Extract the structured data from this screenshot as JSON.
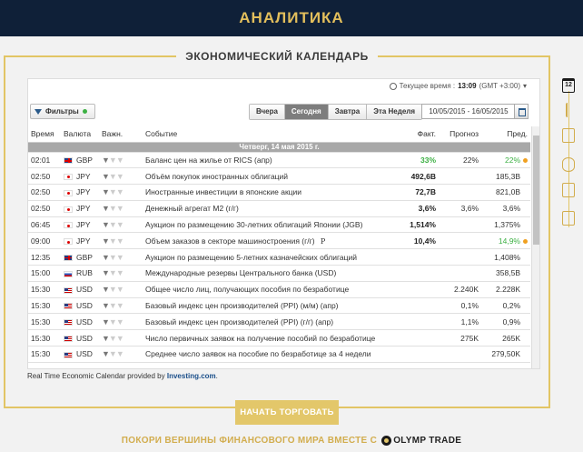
{
  "header": {
    "title": "АНАЛИТИКА"
  },
  "section": {
    "title": "ЭКОНОМИЧЕСКИЙ КАЛЕНДАРЬ"
  },
  "calendar": {
    "time_label": "Текущее время :",
    "time_value": "13:09",
    "timezone": "(GMT +3:00)",
    "filter_label": "Фильтры",
    "tabs": [
      "Вчера",
      "Сегодня",
      "Завтра",
      "Эта Неделя"
    ],
    "active_tab": "Сегодня",
    "date_range": "10/05/2015 - 16/05/2015",
    "columns": {
      "time": "Время",
      "currency": "Валюта",
      "importance": "Важн.",
      "event": "Событие",
      "actual": "Факт.",
      "forecast": "Прогноз",
      "previous": "Пред."
    },
    "day_header": "Четверг, 14 мая 2015 г.",
    "rows": [
      {
        "time": "02:01",
        "flag": "gb",
        "currency": "GBP",
        "importance": 1,
        "event": "Баланс цен на жилье от RICS (апр)",
        "actual": "33%",
        "actual_color": "green",
        "forecast": "22%",
        "previous": "22%",
        "prev_color": "green",
        "alert": true
      },
      {
        "time": "02:50",
        "flag": "jp",
        "currency": "JPY",
        "importance": 1,
        "event": "Объём покупок иностранных облигаций",
        "actual": "492,6B",
        "forecast": "",
        "previous": "185,3B"
      },
      {
        "time": "02:50",
        "flag": "jp",
        "currency": "JPY",
        "importance": 1,
        "event": "Иностранные инвестиции в японские акции",
        "actual": "72,7B",
        "forecast": "",
        "previous": "821,0B"
      },
      {
        "time": "02:50",
        "flag": "jp",
        "currency": "JPY",
        "importance": 1,
        "event": "Денежный агрегат M2 (г/г)",
        "actual": "3,6%",
        "forecast": "3,6%",
        "previous": "3,6%"
      },
      {
        "time": "06:45",
        "flag": "jp",
        "currency": "JPY",
        "importance": 1,
        "event": "Аукцион по размещению 30-летних облигаций Японии (JGB)",
        "actual": "1,514%",
        "forecast": "",
        "previous": "1,375%"
      },
      {
        "time": "09:00",
        "flag": "jp",
        "currency": "JPY",
        "importance": 1,
        "event": "Объем заказов в секторе машиностроения (г/г)",
        "event_note": "P",
        "actual": "10,4%",
        "forecast": "",
        "previous": "14,9%",
        "prev_color": "green",
        "alert": true
      },
      {
        "time": "12:35",
        "flag": "gb",
        "currency": "GBP",
        "importance": 1,
        "event": "Аукцион по размещению 5-летних казначейских облигаций",
        "actual": "",
        "forecast": "",
        "previous": "1,408%"
      },
      {
        "time": "15:00",
        "flag": "ru",
        "currency": "RUB",
        "importance": 1,
        "event": "Международные резервы Центрального банка (USD)",
        "actual": "",
        "forecast": "",
        "previous": "358,5B"
      },
      {
        "time": "15:30",
        "flag": "us",
        "currency": "USD",
        "importance": 1,
        "event": "Общее число лиц, получающих пособия по безработице",
        "actual": "",
        "forecast": "2.240K",
        "previous": "2.228K"
      },
      {
        "time": "15:30",
        "flag": "us",
        "currency": "USD",
        "importance": 1,
        "event": "Базовый индекс цен производителей (PPI) (м/м) (апр)",
        "actual": "",
        "forecast": "0,1%",
        "previous": "0,2%"
      },
      {
        "time": "15:30",
        "flag": "us",
        "currency": "USD",
        "importance": 1,
        "event": "Базовый индекс цен производителей (PPI) (г/г) (апр)",
        "actual": "",
        "forecast": "1,1%",
        "previous": "0,9%"
      },
      {
        "time": "15:30",
        "flag": "us",
        "currency": "USD",
        "importance": 1,
        "event": "Число первичных заявок на получение пособий по безработице",
        "actual": "",
        "forecast": "275K",
        "previous": "265K"
      },
      {
        "time": "15:30",
        "flag": "us",
        "currency": "USD",
        "importance": 1,
        "event": "Среднее число заявок на пособие по безработице за 4 недели",
        "actual": "",
        "forecast": "",
        "previous": "279,50K"
      }
    ],
    "credit_prefix": "Real Time Economic Calendar provided by",
    "credit_brand": "Investing.com",
    "credit_suffix": "."
  },
  "cta": {
    "label": "НАЧАТЬ ТОРГОВАТЬ"
  },
  "footer": {
    "text": "ПОКОРИ ВЕРШИНЫ ФИНАНСОВОГО МИРА ВМЕСТЕ С",
    "brand": "OLYMP TRADE"
  },
  "sidebar_icons": [
    "calendar-icon",
    "candle-icon",
    "settings-sliders-icon",
    "eye-icon",
    "percent-icon",
    "document-icon"
  ],
  "sidebar_calendar_day": "12",
  "colors": {
    "navy": "#0f2038",
    "gold": "#e3bf5c",
    "green": "#3cb043"
  }
}
